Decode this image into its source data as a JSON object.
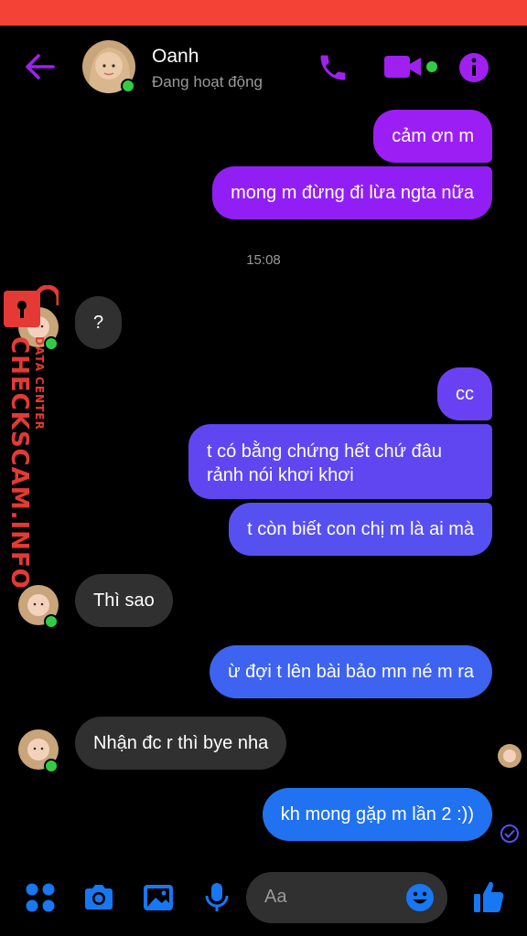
{
  "header": {
    "contact_name": "Oanh",
    "status_text": "Đang hoạt động"
  },
  "icons": {
    "back": "arrow-left-icon",
    "call": "phone-icon",
    "video": "video-camera-icon",
    "info": "info-icon",
    "menu": "four-dots-icon",
    "camera": "camera-icon",
    "gallery": "image-icon",
    "mic": "microphone-icon",
    "emoji": "smiley-icon",
    "like": "thumbs-up-icon"
  },
  "colors": {
    "accent": "#a020f0",
    "bubble_top": "#9b1ff5",
    "bubble_mid": "#5a4ff0",
    "bubble_bottom": "#2072f0",
    "incoming": "#303030",
    "status_bar": "#f44336",
    "online": "#31cc46",
    "watermark": "#e53935",
    "icon_blue": "#1877f2"
  },
  "messages": [
    {
      "text": "cảm ơn m"
    },
    {
      "text": "mong m đừng đi lừa ngta nữa"
    },
    {
      "text": "?"
    },
    {
      "text": "cc"
    },
    {
      "text": "t có bằng chứng hết chứ đâu rảnh nói khơi khơi"
    },
    {
      "text": "t còn biết con chị m là ai mà"
    },
    {
      "text": "Thì sao"
    },
    {
      "text": "ừ đợi t lên bài bảo mn né m ra"
    },
    {
      "text": "Nhận đc r thì bye nha"
    },
    {
      "text": "kh mong gặp m lần 2 :))"
    }
  ],
  "timestamp": "15:08",
  "watermark": {
    "text": "CHECKSCAM.INFO",
    "sub": "DATA CENTER"
  },
  "composer": {
    "placeholder": "Aa"
  }
}
